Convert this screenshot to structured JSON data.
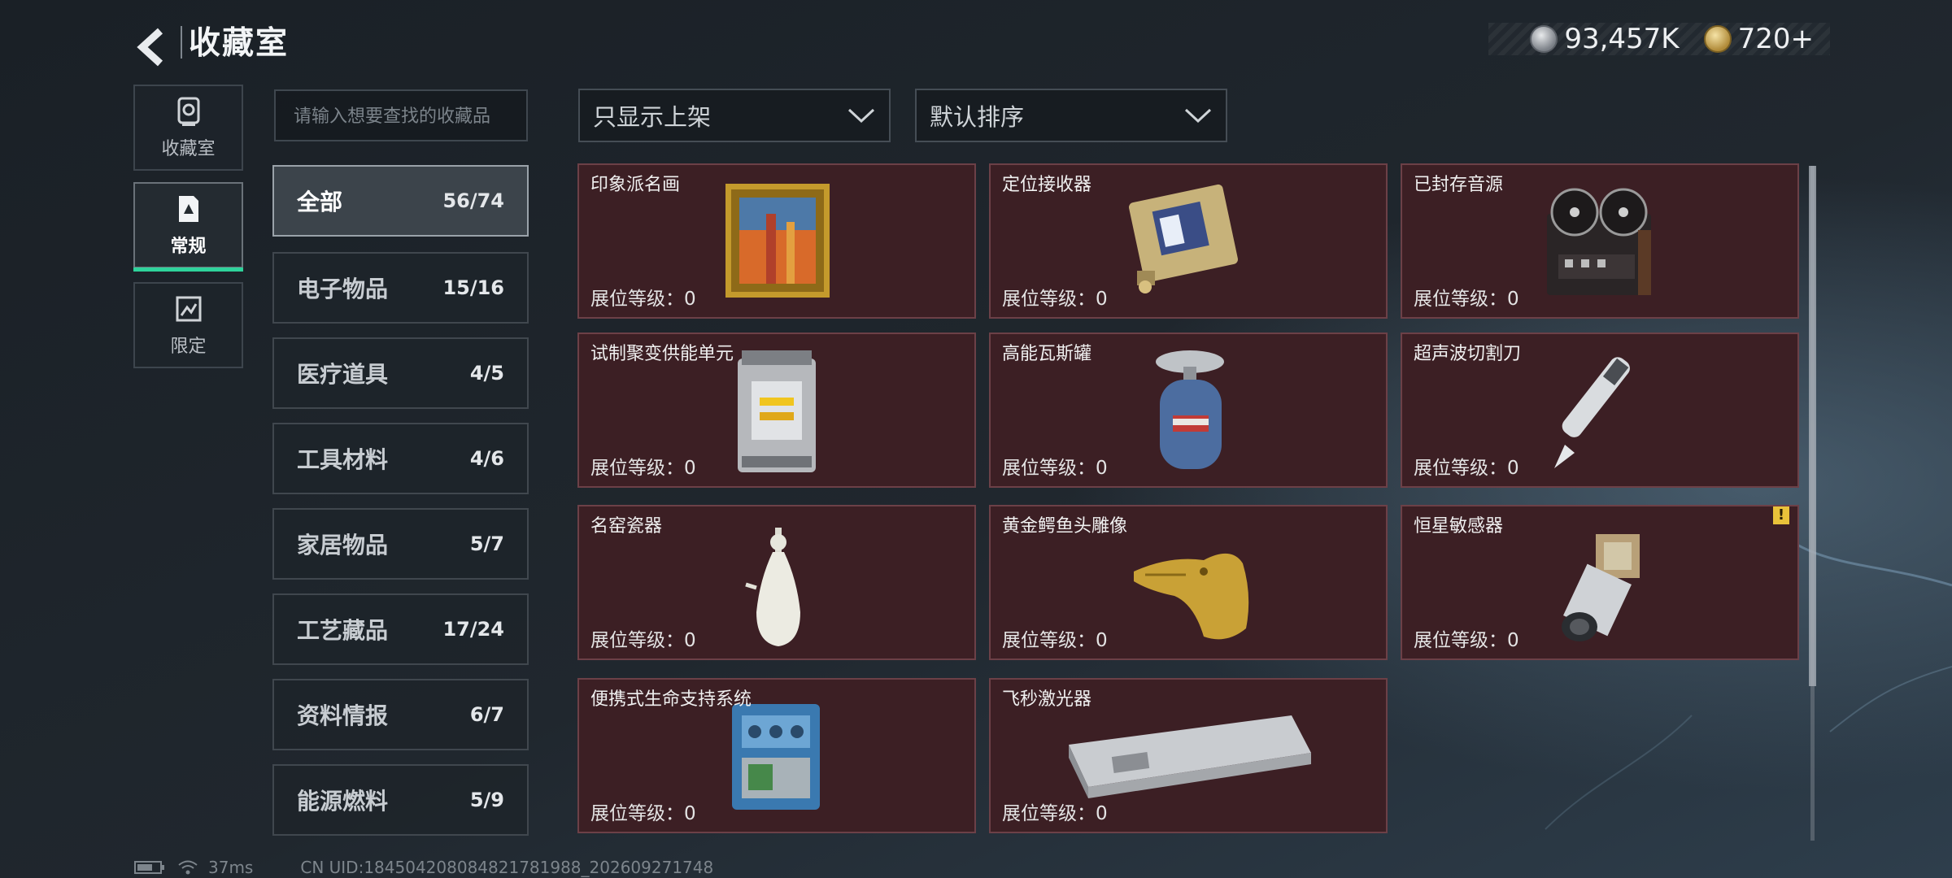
{
  "header": {
    "title": "收藏室",
    "currency": [
      {
        "icon": "silver-coin-icon",
        "value": "93,457K"
      },
      {
        "icon": "gold-coin-icon",
        "value": "720+"
      }
    ]
  },
  "mode_tabs": [
    {
      "label": "收藏室",
      "icon": "trophy-icon",
      "active": false
    },
    {
      "label": "常规",
      "icon": "regular-item-icon",
      "active": true
    },
    {
      "label": "限定",
      "icon": "limited-item-icon",
      "active": false
    }
  ],
  "search": {
    "placeholder": "请输入想要查找的收藏品"
  },
  "categories": [
    {
      "name": "全部",
      "count": "56/74",
      "active": true
    },
    {
      "name": "电子物品",
      "count": "15/16"
    },
    {
      "name": "医疗道具",
      "count": "4/5"
    },
    {
      "name": "工具材料",
      "count": "4/6"
    },
    {
      "name": "家居物品",
      "count": "5/7"
    },
    {
      "name": "工艺藏品",
      "count": "17/24"
    },
    {
      "name": "资料情报",
      "count": "6/7"
    },
    {
      "name": "能源燃料",
      "count": "5/9"
    }
  ],
  "filters": {
    "shelf_filter": "只显示上架",
    "sort": "默认排序"
  },
  "items": [
    {
      "name": "印象派名画",
      "level_label": "展位等级：",
      "level": "0",
      "icon": "painting-icon"
    },
    {
      "name": "定位接收器",
      "level_label": "展位等级：",
      "level": "0",
      "icon": "gps-receiver-icon"
    },
    {
      "name": "已封存音源",
      "level_label": "展位等级：",
      "level": "0",
      "icon": "reel-recorder-icon"
    },
    {
      "name": "试制聚变供能单元",
      "level_label": "展位等级：",
      "level": "0",
      "icon": "fusion-unit-icon"
    },
    {
      "name": "高能瓦斯罐",
      "level_label": "展位等级：",
      "level": "0",
      "icon": "gas-canister-icon"
    },
    {
      "name": "超声波切割刀",
      "level_label": "展位等级：",
      "level": "0",
      "icon": "ultrasonic-knife-icon"
    },
    {
      "name": "名窑瓷器",
      "level_label": "展位等级：",
      "level": "0",
      "icon": "porcelain-vase-icon"
    },
    {
      "name": "黄金鳄鱼头雕像",
      "level_label": "展位等级：",
      "level": "0",
      "icon": "gold-crocodile-icon"
    },
    {
      "name": "恒星敏感器",
      "level_label": "展位等级：",
      "level": "0",
      "icon": "star-sensor-icon",
      "warning": "!"
    },
    {
      "name": "便携式生命支持系统",
      "level_label": "展位等级：",
      "level": "0",
      "icon": "life-support-icon"
    },
    {
      "name": "飞秒激光器",
      "level_label": "展位等级：",
      "level": "0",
      "icon": "femtosecond-laser-icon"
    }
  ],
  "status_bar": {
    "ping": "37ms",
    "uid": "CN UID:1845042080848217819​88_202609271748"
  }
}
